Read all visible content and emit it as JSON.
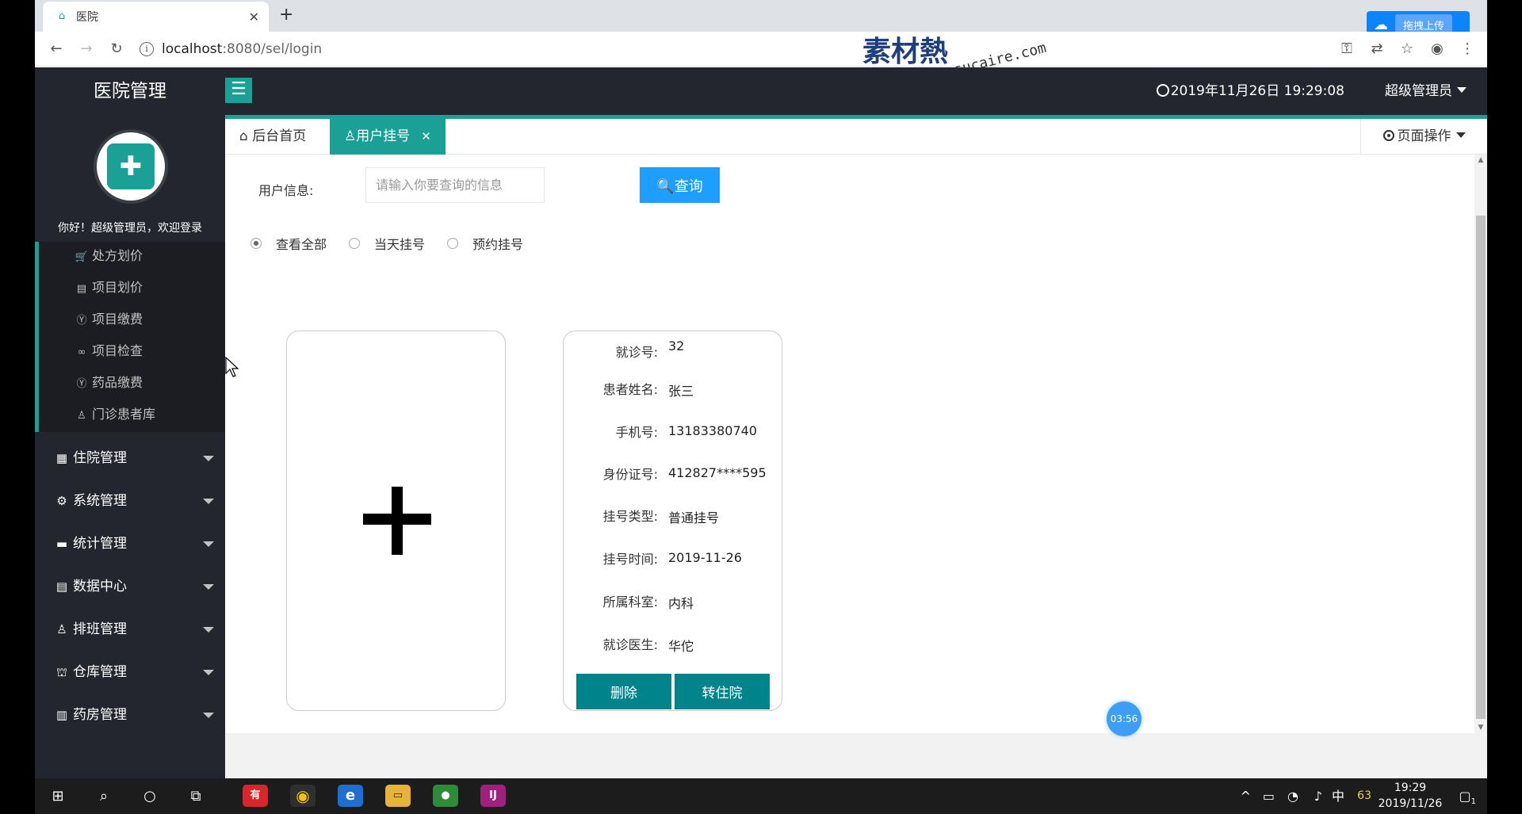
{
  "browser": {
    "tab_title": "医院",
    "url_host": "localhost",
    "url_path": ":8080/sel/login",
    "upload_label": "拖拽上传",
    "watermark_main": "素材熱",
    "watermark_sub": "sucaire.com"
  },
  "header": {
    "app_name": "医院管理",
    "clock": "2019年11月26日 19:29:08",
    "user": "超级管理员"
  },
  "sidebar": {
    "welcome": "你好！超级管理员，欢迎登录",
    "sub_items": [
      {
        "label": "处方划价",
        "icon": "cart-icon"
      },
      {
        "label": "项目划价",
        "icon": "document-icon"
      },
      {
        "label": "项目缴费",
        "icon": "yen-icon"
      },
      {
        "label": "项目检查",
        "icon": "infinity-icon"
      },
      {
        "label": "药品缴费",
        "icon": "yen-icon"
      },
      {
        "label": "门诊患者库",
        "icon": "user-icon"
      }
    ],
    "main_items": [
      {
        "label": "住院管理",
        "icon": "building-icon"
      },
      {
        "label": "系统管理",
        "icon": "gear-icon"
      },
      {
        "label": "统计管理",
        "icon": "monitor-icon"
      },
      {
        "label": "数据中心",
        "icon": "document-icon"
      },
      {
        "label": "排班管理",
        "icon": "user-icon"
      },
      {
        "label": "仓库管理",
        "icon": "warehouse-icon"
      },
      {
        "label": "药房管理",
        "icon": "book-icon"
      }
    ]
  },
  "tabs": {
    "home": "后台首页",
    "active": "用户挂号",
    "page_ops": "页面操作"
  },
  "query": {
    "label": "用户信息:",
    "placeholder": "请输入你要查询的信息",
    "button": "查询"
  },
  "filters": [
    {
      "label": "查看全部",
      "checked": true
    },
    {
      "label": "当天挂号",
      "checked": false
    },
    {
      "label": "预约挂号",
      "checked": false
    }
  ],
  "card": {
    "fields": [
      {
        "key": "就诊号:",
        "value": "32"
      },
      {
        "key": "患者姓名:",
        "value": "张三"
      },
      {
        "key": "手机号:",
        "value": "13183380740"
      },
      {
        "key": "身份证号:",
        "value": "412827****595"
      },
      {
        "key": "挂号类型:",
        "value": "普通挂号"
      },
      {
        "key": "挂号时间:",
        "value": "2019-11-26"
      },
      {
        "key": "所属科室:",
        "value": "内科"
      },
      {
        "key": "就诊医生:",
        "value": "华佗"
      }
    ],
    "delete_label": "删除",
    "transfer_label": "转住院"
  },
  "timer": "03:56",
  "taskbar": {
    "time": "19:29",
    "date": "2019/11/26",
    "ime": "中",
    "battery": "63",
    "notifications": "1"
  },
  "colors": {
    "accent": "#1aa094",
    "query_blue": "#1e9fff",
    "card_button": "#00848c",
    "sidebar_bg": "#23262e"
  }
}
